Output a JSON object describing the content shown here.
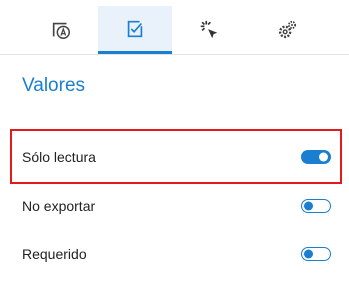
{
  "tabs": [
    {
      "icon": "form-a-icon"
    },
    {
      "icon": "checkbox-edit-icon",
      "active": true
    },
    {
      "icon": "cursor-click-icon"
    },
    {
      "icon": "gears-icon"
    }
  ],
  "section": {
    "title": "Valores"
  },
  "properties": [
    {
      "label": "Sólo lectura",
      "enabled": true
    },
    {
      "label": "No exportar",
      "enabled": false
    },
    {
      "label": "Requerido",
      "enabled": false
    }
  ],
  "colors": {
    "accent": "#1a7fd0",
    "highlight": "#e11b1b"
  }
}
